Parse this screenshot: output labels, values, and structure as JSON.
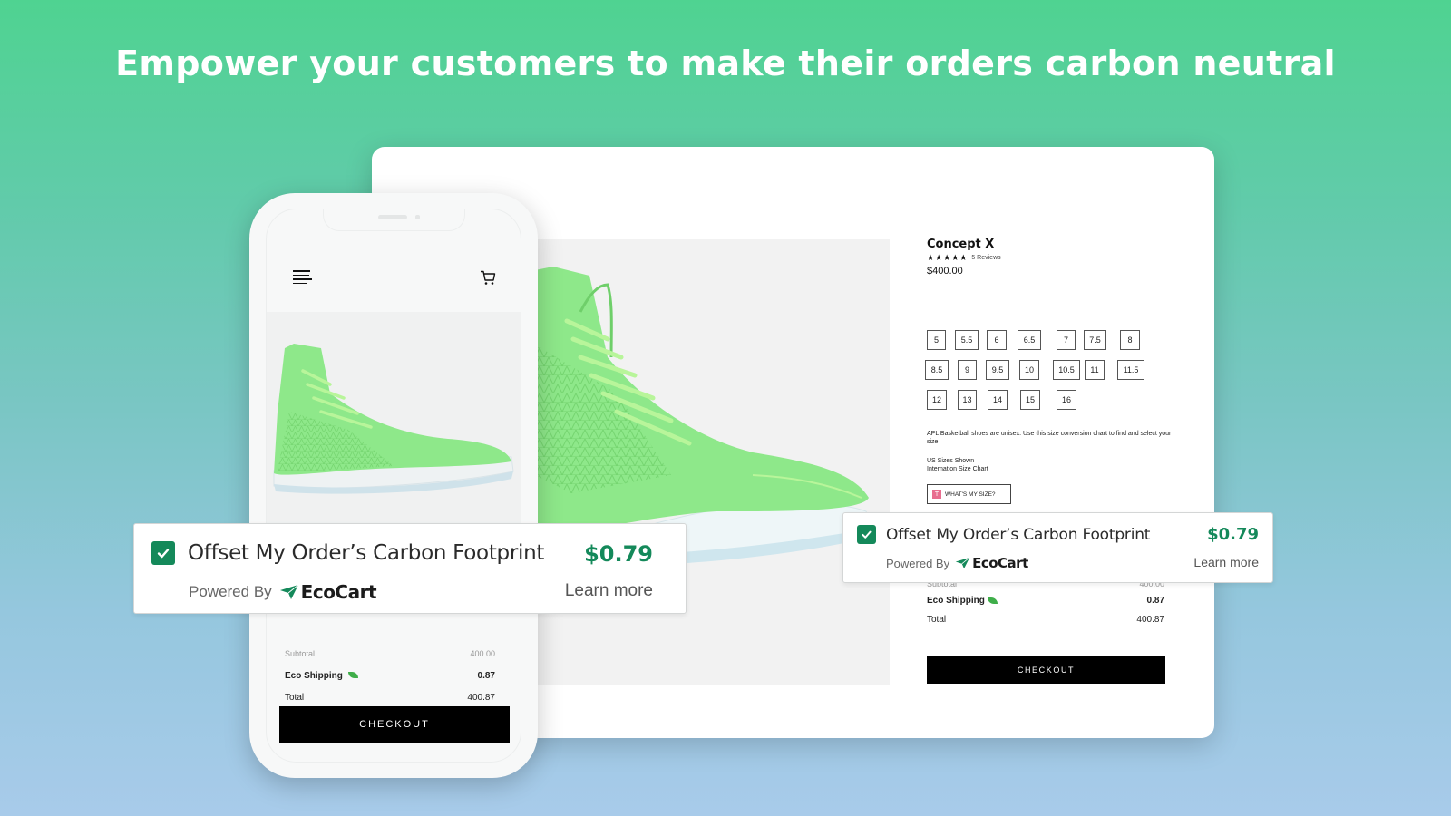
{
  "headline": "Empower your customers to make their orders carbon neutral",
  "colors": {
    "accent_green": "#14895a",
    "leaf_green": "#3fae4a",
    "shoe_green": "#8ee88a",
    "checkout_bg": "#000000",
    "size_badge_pink": "#e86d8f"
  },
  "desktop": {
    "product": {
      "name": "Concept X",
      "stars": "★★★★★",
      "rating": 5,
      "reviews": "5 Reviews",
      "price": "$400.00"
    },
    "sizes": [
      "5",
      "5.5",
      "6",
      "6.5",
      "7",
      "7.5",
      "8",
      "8.5",
      "9",
      "9.5",
      "10",
      "10.5",
      "11",
      "11.5",
      "12",
      "13",
      "14",
      "15",
      "16"
    ],
    "size_note": "APL Basketball shoes are unisex. Use this size conversion chart to find and select your size",
    "size_links": [
      "US Sizes Shown",
      "Internation Size Chart"
    ],
    "whats_my_size": {
      "badge": "T",
      "label": "WHAT'S MY SIZE?"
    },
    "summary": {
      "subtotal_label": "Subtotal",
      "subtotal_value": "400.00",
      "eco_label": "Eco Shipping",
      "eco_value": "0.87",
      "total_label": "Total",
      "total_value": "400.87"
    },
    "checkout_label": "CHECKOUT"
  },
  "phone": {
    "summary": {
      "subtotal_label": "Subtotal",
      "subtotal_value": "400.00",
      "eco_label": "Eco Shipping",
      "eco_value": "0.87",
      "total_label": "Total",
      "total_value": "400.87"
    },
    "checkout_label": "CHECKOUT"
  },
  "eco_widget": {
    "checked": true,
    "title": "Offset My Order’s Carbon Footprint",
    "price": "$0.79",
    "powered_by": "Powered By",
    "brand": "EcoCart",
    "learn_more": "Learn more"
  }
}
